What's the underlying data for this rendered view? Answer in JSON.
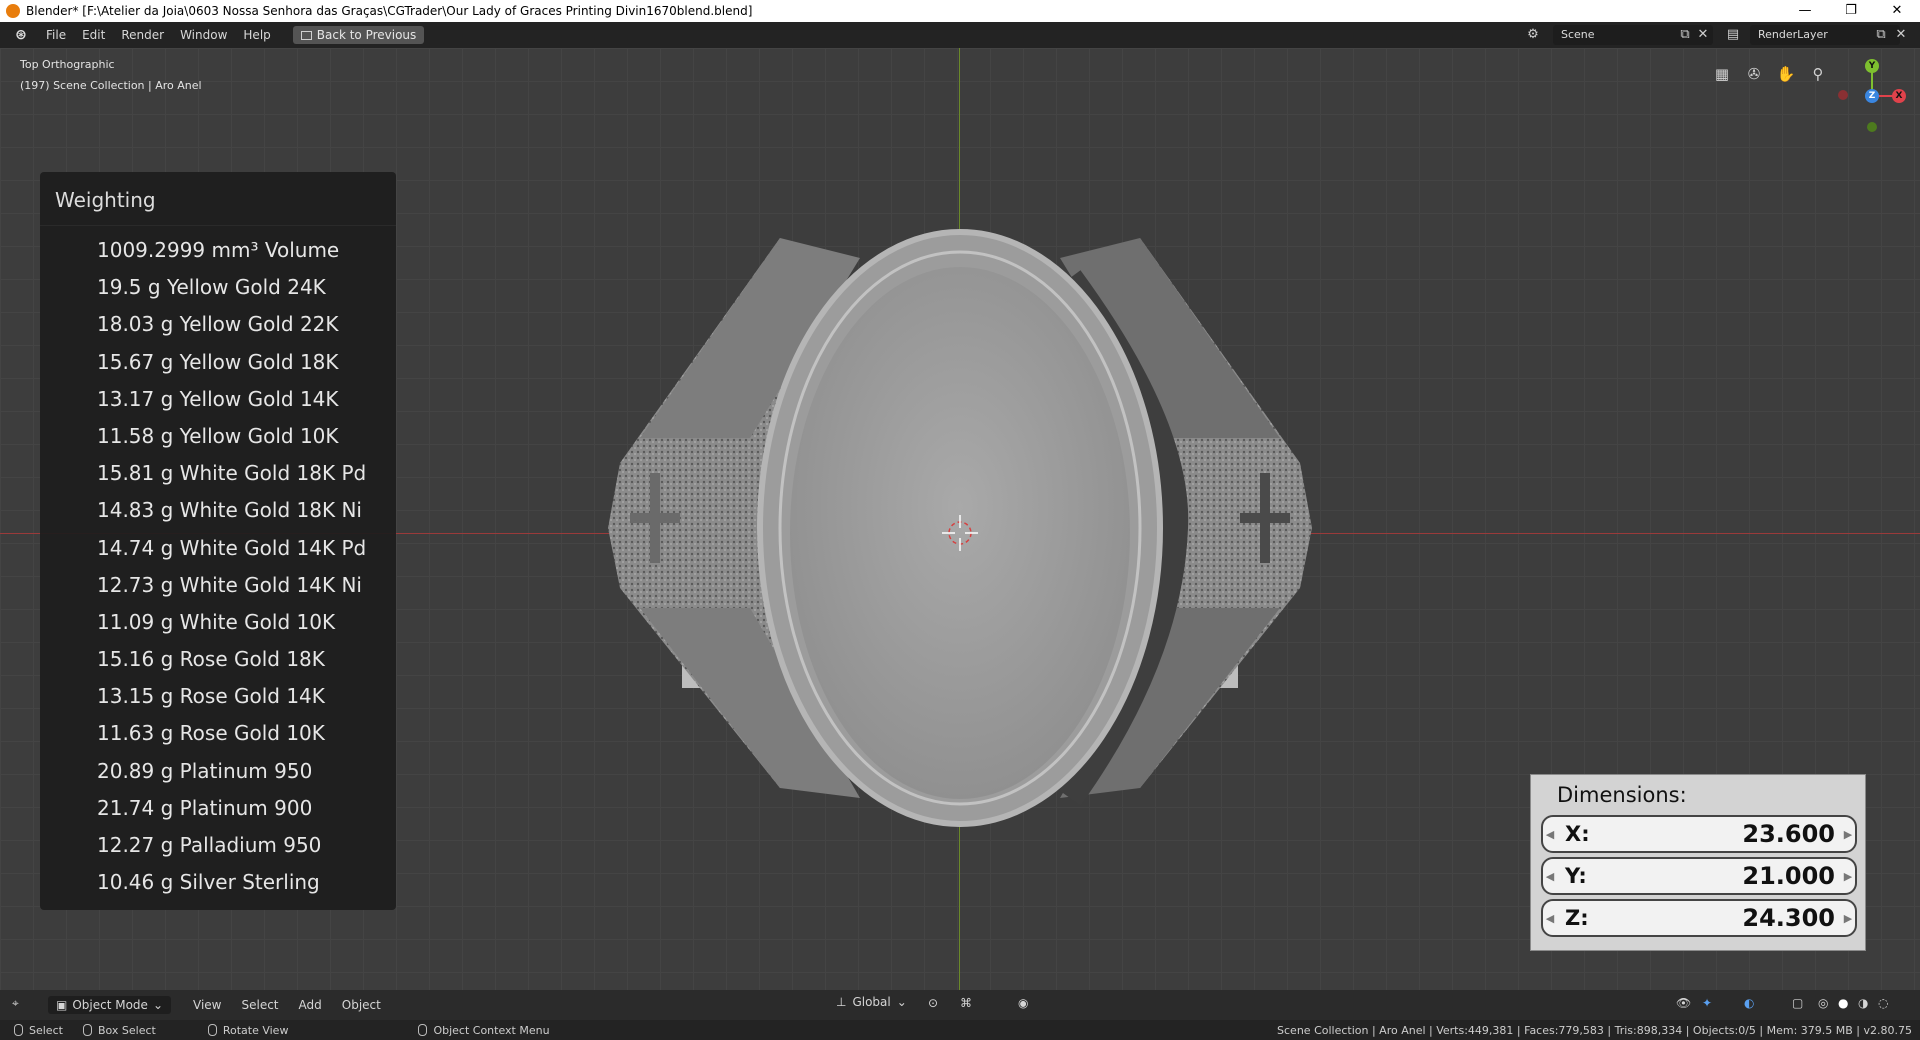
{
  "window": {
    "title": "Blender* [F:\\Atelier da Joia\\0603 Nossa Senhora das Graças\\CGTrader\\Our Lady of Graces Printing Divin1670blend.blend]",
    "controls": [
      "—",
      "❐",
      "✕"
    ]
  },
  "menubar": {
    "items": [
      "File",
      "Edit",
      "Render",
      "Window",
      "Help"
    ],
    "back_button": "Back to Previous",
    "scene": "Scene",
    "render_layer": "RenderLayer"
  },
  "viewport": {
    "view_name": "Top Orthographic",
    "collection": "(197) Scene Collection | Aro Anel",
    "gizmo_axes": {
      "x": "X",
      "y": "Y",
      "z": "Z"
    }
  },
  "weighting": {
    "title": "Weighting",
    "rows": [
      "1009.2999 mm³  Volume",
      "19.5 g  Yellow Gold 24K",
      "18.03 g  Yellow Gold 22K",
      "15.67 g  Yellow Gold 18K",
      "13.17 g  Yellow Gold 14K",
      "11.58 g  Yellow Gold 10K",
      "15.81 g  White Gold 18K Pd",
      "14.83 g  White Gold 18K Ni",
      "14.74 g  White Gold 14K Pd",
      "12.73 g  White Gold 14K Ni",
      "11.09 g  White Gold 10K",
      "15.16 g  Rose Gold 18K",
      "13.15 g  Rose Gold 14K",
      "11.63 g  Rose Gold 10K",
      "20.89 g  Platinum 950",
      "21.74 g  Platinum 900",
      "12.27 g  Palladium 950",
      "10.46 g  Silver Sterling"
    ]
  },
  "dimensions": {
    "title": "Dimensions:",
    "x_label": "X:",
    "x_value": "23.600",
    "y_label": "Y:",
    "y_value": "21.000",
    "z_label": "Z:",
    "z_value": "24.300"
  },
  "viewport_header": {
    "mode": "Object Mode",
    "items": [
      "View",
      "Select",
      "Add",
      "Object"
    ],
    "orientation": "Global"
  },
  "statusbar": {
    "select": "Select",
    "box_select": "Box Select",
    "rotate": "Rotate View",
    "context_menu": "Object Context Menu",
    "stats": "Scene Collection | Aro Anel | Verts:449,381 | Faces:779,583 | Tris:898,334 | Objects:0/5 | Mem: 379.5 MB | v2.80.75"
  },
  "colors": {
    "x_axis": "#e0424b",
    "y_axis": "#7ec02f",
    "z_axis": "#3a86e0"
  }
}
